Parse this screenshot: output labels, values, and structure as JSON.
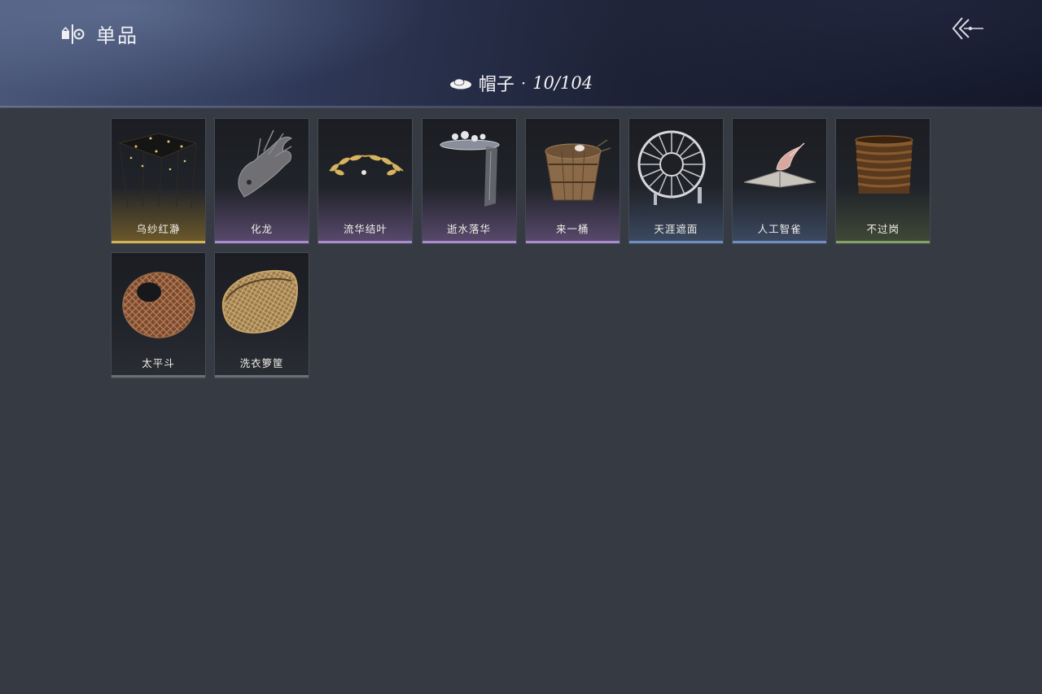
{
  "header": {
    "title": "单品",
    "title_icon": "wardrobe-icon",
    "back_icon": "back-arrow-icon"
  },
  "category": {
    "name": "帽子",
    "separator": "·",
    "count": "10/104",
    "icon": "hat-icon"
  },
  "items": [
    {
      "label": "乌纱红瀞",
      "rarity": "gold"
    },
    {
      "label": "化龙",
      "rarity": "purple"
    },
    {
      "label": "流华结叶",
      "rarity": "purple"
    },
    {
      "label": "逝水落华",
      "rarity": "purple"
    },
    {
      "label": "来一桶",
      "rarity": "purple"
    },
    {
      "label": "天涯遮面",
      "rarity": "blue"
    },
    {
      "label": "人工智雀",
      "rarity": "blue"
    },
    {
      "label": "不过岗",
      "rarity": "green"
    },
    {
      "label": "太平斗",
      "rarity": "plain"
    },
    {
      "label": "洗衣箩筐",
      "rarity": "plain"
    }
  ],
  "colors": {
    "background": "#363a43",
    "gold": "#d4b455",
    "purple": "#a88ccc",
    "blue": "#6f8fc2",
    "green": "#84a166"
  }
}
